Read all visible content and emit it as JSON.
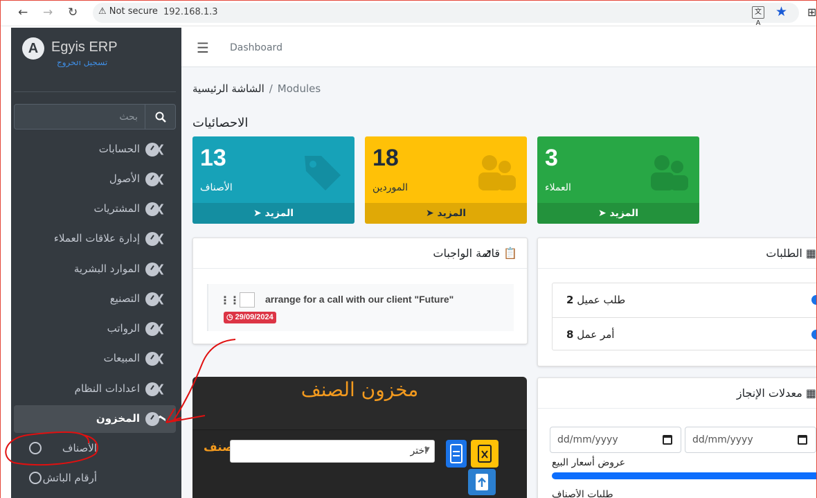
{
  "browser": {
    "security_label": "Not secure",
    "url": "192.168.1.3",
    "translate_label": "文A"
  },
  "brand": {
    "name": "Egyis ERP",
    "user_link": "تسجيل الخروج"
  },
  "search": {
    "placeholder": "بحث"
  },
  "menu": [
    {
      "label": "الحسابات"
    },
    {
      "label": "الأصول"
    },
    {
      "label": "المشتريات"
    },
    {
      "label": "إدارة علاقات العملاء"
    },
    {
      "label": "الموارد البشرية"
    },
    {
      "label": "التصنيع"
    },
    {
      "label": "الرواتب"
    },
    {
      "label": "المبيعات"
    },
    {
      "label": "اعدادات النظام"
    },
    {
      "label": "المخزون",
      "active": true
    }
  ],
  "submenu": [
    {
      "label": "الأصناف"
    },
    {
      "label": "أرقام الباتش"
    }
  ],
  "topbar": {
    "dashboard": "Dashboard"
  },
  "breadcrumb": {
    "home": "الشاشة الرئيسية",
    "current": "Modules"
  },
  "stats": {
    "title": "الاحصائيات",
    "boxes": [
      {
        "number": "13",
        "caption": "الأصناف",
        "more": "المزيد",
        "color": "#17a2b8"
      },
      {
        "number": "18",
        "caption": "الموردين",
        "more": "المزيد",
        "color": "#ffc107"
      },
      {
        "number": "3",
        "caption": "العملاء",
        "more": "المزيد",
        "color": "#28a745"
      }
    ]
  },
  "todo": {
    "title": "قائمة الواجبات",
    "item_text": "arrange for a call with our client \"Future\"",
    "due": "29/09/2024"
  },
  "requests": {
    "title": "الطلبات",
    "items": [
      {
        "label": "طلب عميل",
        "count": "2"
      },
      {
        "label": "أمر عمل",
        "count": "8"
      }
    ]
  },
  "achievement": {
    "title": "معدلات الإنجاز",
    "date_from": "dd/mm/yyyy",
    "date_to": "dd/mm/yyyy",
    "metric_label": "عروض أسعار البيع",
    "metric_progress": 1.0,
    "next_label": "طلبات الأصناف"
  },
  "stock_panel": {
    "title": "مخزون الصنف",
    "field_label": "صنف",
    "select_value": "اختر"
  }
}
